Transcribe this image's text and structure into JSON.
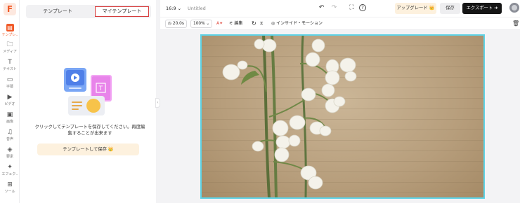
{
  "rail": {
    "items": [
      {
        "label": "テンプレ..",
        "icon": "template-icon"
      },
      {
        "label": "メディア",
        "icon": "media-folder-icon"
      },
      {
        "label": "テキスト",
        "icon": "text-icon"
      },
      {
        "label": "字幕",
        "icon": "subtitle-icon"
      },
      {
        "label": "ビデオ",
        "icon": "video-icon"
      },
      {
        "label": "画像",
        "icon": "image-icon"
      },
      {
        "label": "音声",
        "icon": "music-icon"
      },
      {
        "label": "要素",
        "icon": "elements-icon"
      },
      {
        "label": "エフェク..",
        "icon": "effects-icon"
      },
      {
        "label": "ツール",
        "icon": "tools-icon"
      }
    ]
  },
  "panel": {
    "tabs": [
      "テンプレート",
      "マイテンプレート"
    ],
    "active_tab": "マイテンプレート",
    "empty_message": "クリックしてテンプレートを保存してください。再度編集することが出来ます",
    "save_button": "テンプレートして保存 👑"
  },
  "topbar": {
    "aspect_ratio": "16:9 ⌄",
    "doc_name": "Untitled",
    "upgrade_label": "アップグレード 👑",
    "save_label": "保存",
    "export_label": "エクスポート ➜"
  },
  "toolbar": {
    "duration": "20.0s",
    "zoom": "100% ⌄",
    "edit_label": "編集",
    "animation_label": "インサイド・モーション"
  },
  "colors": {
    "accent": "#f05a28",
    "selection": "#5ed3e6",
    "export_bg": "#151515",
    "upgrade_bg": "#fdf1de"
  }
}
